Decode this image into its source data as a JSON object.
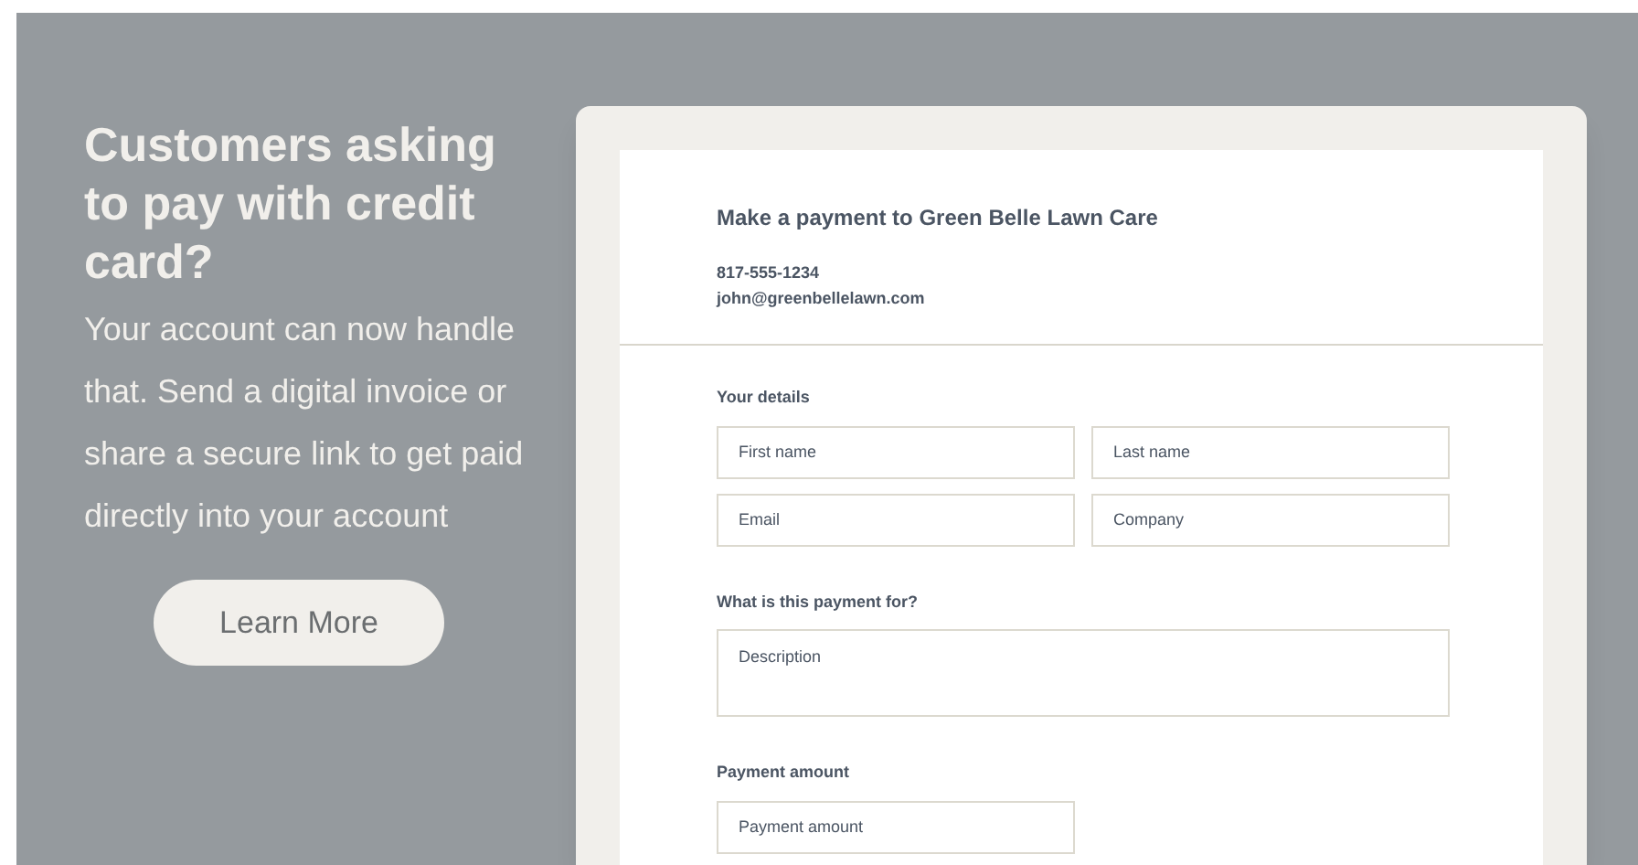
{
  "promo": {
    "heading": "Customers asking to pay with credit card?",
    "body": "Your account can now handle that. Send a digital invoice or share a secure link to get paid directly into your account",
    "button": "Learn More"
  },
  "form": {
    "title": "Make a payment to Green Belle Lawn Care",
    "phone": "817-555-1234",
    "email": "john@greenbellelawn.com",
    "sections": [
      {
        "label": "Your details",
        "fields": [
          {
            "kind": "half",
            "placeholder": "First name"
          },
          {
            "kind": "half",
            "placeholder": "Last name"
          },
          {
            "kind": "half",
            "placeholder": "Email"
          },
          {
            "kind": "half",
            "placeholder": "Company"
          }
        ]
      },
      {
        "label": "What is this payment for?",
        "fields": [
          {
            "kind": "textarea",
            "placeholder": "Description"
          }
        ]
      },
      {
        "label": "Payment amount",
        "fields": [
          {
            "kind": "half",
            "placeholder": "Payment amount"
          }
        ]
      }
    ]
  }
}
